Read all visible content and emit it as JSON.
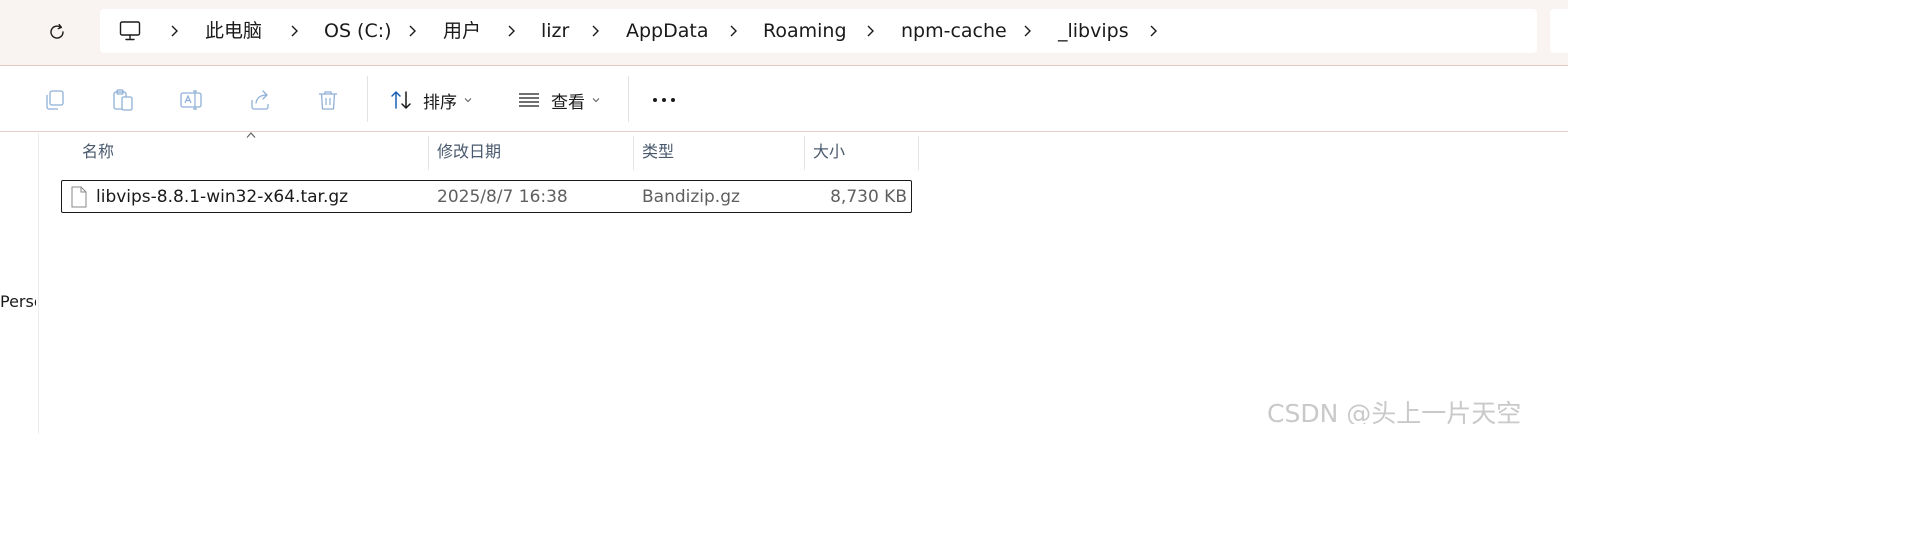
{
  "address_bar": {
    "crumbs": [
      "此电脑",
      "OS (C:)",
      "用户",
      "lizr",
      "AppData",
      "Roaming",
      "npm-cache",
      "_libvips"
    ]
  },
  "toolbar": {
    "sort_label": "排序",
    "view_label": "查看"
  },
  "nav_pane": {
    "partial_label": "Perso"
  },
  "file_list": {
    "columns": [
      "名称",
      "修改日期",
      "类型",
      "大小"
    ],
    "rows": [
      {
        "name": "libvips-8.8.1-win32-x64.tar.gz",
        "modified": "2025/8/7 16:38",
        "type": "Bandizip.gz",
        "size": "8,730 KB"
      }
    ]
  },
  "watermark": "CSDN @头上一片天空",
  "icons": {
    "refresh": "refresh-icon",
    "pc": "this-pc-icon",
    "copy": "copy-icon",
    "paste": "paste-icon",
    "rename": "rename-icon",
    "share": "share-icon",
    "delete": "delete-icon",
    "sort": "sort-icon",
    "view": "view-icon",
    "more": "more-icon",
    "file": "file-icon"
  },
  "colors": {
    "topbar_bg": "#f9f3f1",
    "accent_line": "#e8cdc3",
    "disabled_icon": "#8fb0d6",
    "header_text": "#4a5a6e"
  }
}
